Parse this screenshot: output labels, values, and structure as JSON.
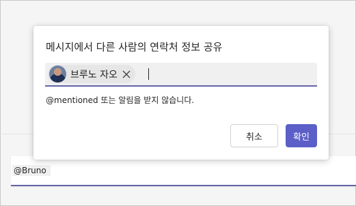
{
  "compose": {
    "mention_text": "@Bruno"
  },
  "dialog": {
    "title": "메시지에서 다른 사람의 연락처 정보 공유",
    "chip_name": "브루노 자오",
    "note": "@mentioned 또는 알림을 받지 않습니다.",
    "cancel_label": "취소",
    "confirm_label": "확인"
  },
  "colors": {
    "accent": "#6264a7",
    "primary_button": "#5b5fc7"
  }
}
